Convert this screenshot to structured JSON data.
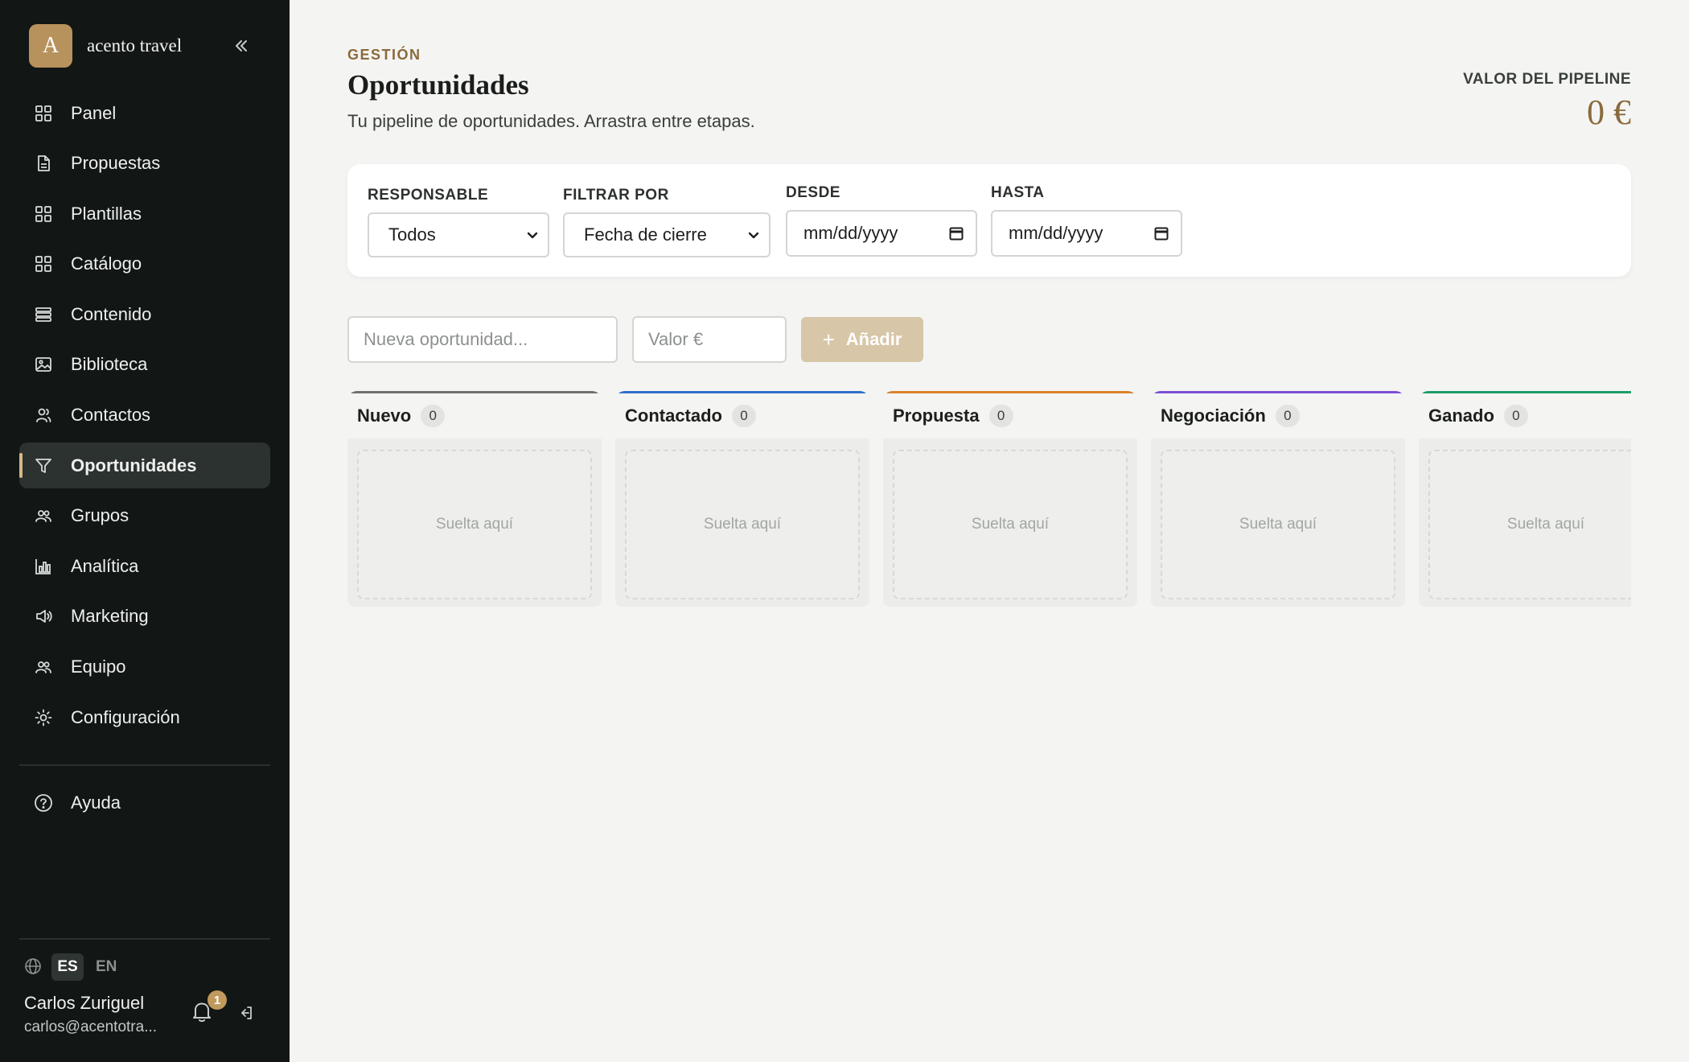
{
  "brand": {
    "logo_letter": "A",
    "name": "acento travel"
  },
  "sidebar": {
    "collapse_icon": "double-chevron-left-icon",
    "items": [
      {
        "label": "Panel",
        "icon": "grid-icon"
      },
      {
        "label": "Propuestas",
        "icon": "document-icon"
      },
      {
        "label": "Plantillas",
        "icon": "grid-icon"
      },
      {
        "label": "Catálogo",
        "icon": "grid-icon"
      },
      {
        "label": "Contenido",
        "icon": "layers-icon"
      },
      {
        "label": "Biblioteca",
        "icon": "image-icon"
      },
      {
        "label": "Contactos",
        "icon": "user-icon"
      },
      {
        "label": "Oportunidades",
        "icon": "filter-icon",
        "active": true
      },
      {
        "label": "Grupos",
        "icon": "users-icon"
      },
      {
        "label": "Analítica",
        "icon": "bar-chart-icon"
      },
      {
        "label": "Marketing",
        "icon": "megaphone-icon"
      },
      {
        "label": "Equipo",
        "icon": "users-icon"
      },
      {
        "label": "Configuración",
        "icon": "gear-icon"
      }
    ],
    "help": {
      "label": "Ayuda",
      "icon": "help-circle-icon"
    },
    "languages": [
      "ES",
      "EN"
    ],
    "active_language": "ES",
    "user": {
      "name": "Carlos Zuriguel",
      "email": "carlos@acentotra..."
    },
    "notifications_count": "1"
  },
  "header": {
    "eyebrow": "GESTIÓN",
    "title": "Oportunidades",
    "subtitle": "Tu pipeline de oportunidades. Arrastra entre etapas.",
    "pipeline_label": "VALOR DEL PIPELINE",
    "pipeline_value": "0 €"
  },
  "filters": {
    "responsable": {
      "label": "RESPONSABLE",
      "value": "Todos"
    },
    "filtrar_por": {
      "label": "FILTRAR POR",
      "value": "Fecha de cierre"
    },
    "desde": {
      "label": "DESDE",
      "value": "mm/dd/yyyy"
    },
    "hasta": {
      "label": "HASTA",
      "value": "mm/dd/yyyy"
    }
  },
  "add_form": {
    "name_placeholder": "Nueva oportunidad...",
    "value_placeholder": "Valor €",
    "add_label": "Añadir"
  },
  "columns": [
    {
      "title": "Nuevo",
      "count": "0",
      "color": "#6f6f6f",
      "drop_text": "Suelta aquí"
    },
    {
      "title": "Contactado",
      "count": "0",
      "color": "#2f6fc9",
      "drop_text": "Suelta aquí"
    },
    {
      "title": "Propuesta",
      "count": "0",
      "color": "#d9822b",
      "drop_text": "Suelta aquí"
    },
    {
      "title": "Negociación",
      "count": "0",
      "color": "#7d4fd6",
      "drop_text": "Suelta aquí"
    },
    {
      "title": "Ganado",
      "count": "0",
      "color": "#1f9d6a",
      "drop_text": "Suelta aquí"
    }
  ]
}
